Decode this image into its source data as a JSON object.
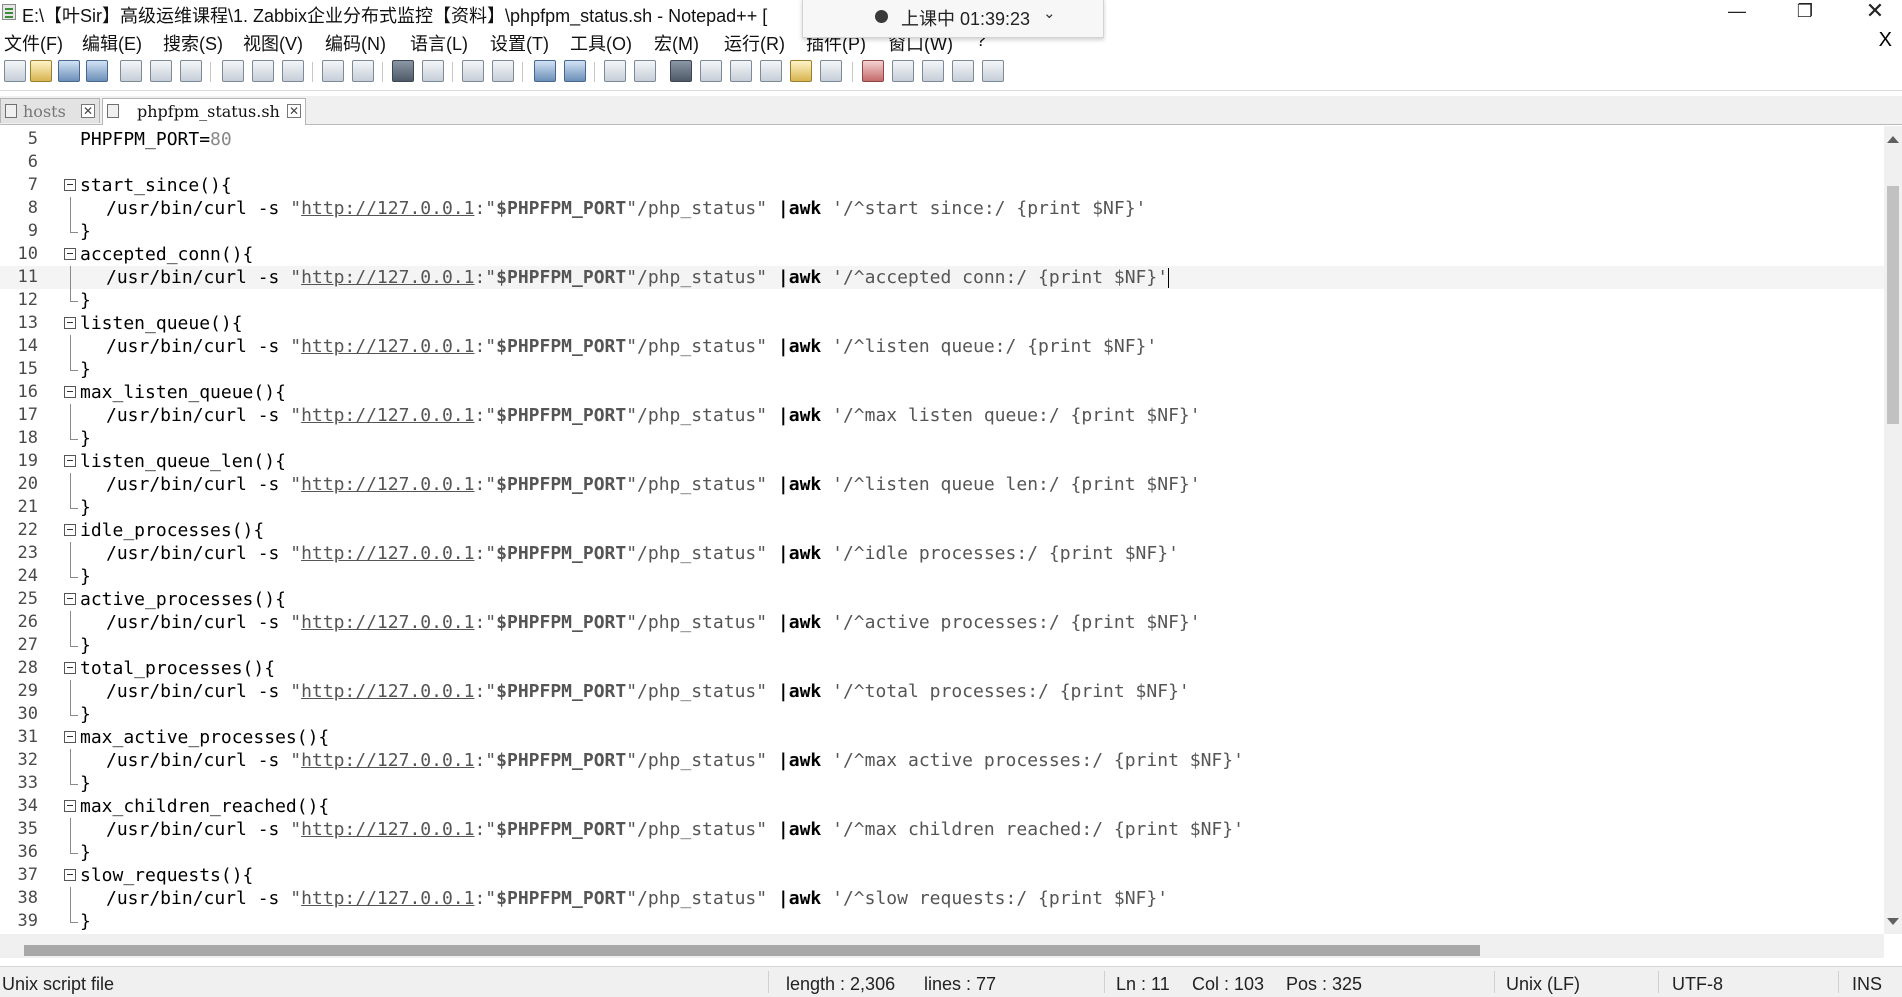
{
  "window": {
    "title": "E:\\【叶Sir】高级运维课程\\1. Zabbix企业分布式监控【资料】\\phpfpm_status.sh - Notepad++ [",
    "minimize_glyph": "—",
    "restore_glyph": "❐",
    "close_glyph": "✕"
  },
  "recording": {
    "text": "上课中 01:39:23",
    "chevron": "⌄"
  },
  "menu": {
    "items": [
      "文件(F)",
      "编辑(E)",
      "搜索(S)",
      "视图(V)",
      "编码(N)",
      "语言(L)",
      "设置(T)",
      "工具(O)",
      "宏(M)",
      "运行(R)",
      "插件(P)",
      "窗口(W)",
      "?"
    ],
    "close_glyph": "X"
  },
  "tabs": [
    {
      "label": "hosts",
      "active": false
    },
    {
      "label": "phpfpm_status.sh",
      "active": true
    }
  ],
  "editor": {
    "current_line": 11,
    "lines": [
      {
        "n": "5",
        "kind": "plain",
        "fold": "none",
        "text": "PHPFPM_PORT=80"
      },
      {
        "n": "6",
        "kind": "blank",
        "fold": "none",
        "text": ""
      },
      {
        "n": "7",
        "kind": "func",
        "fold": "start",
        "text": "start_since(){"
      },
      {
        "n": "8",
        "kind": "curl",
        "fold": "mid",
        "pattern": "'/^start since:/ {print $NF}'"
      },
      {
        "n": "9",
        "kind": "close",
        "fold": "end",
        "text": "}"
      },
      {
        "n": "10",
        "kind": "func",
        "fold": "start",
        "text": "accepted_conn(){"
      },
      {
        "n": "11",
        "kind": "curl",
        "fold": "mid",
        "pattern": "'/^accepted conn:/ {print $NF}'"
      },
      {
        "n": "12",
        "kind": "close",
        "fold": "end",
        "text": "}"
      },
      {
        "n": "13",
        "kind": "func",
        "fold": "start",
        "text": "listen_queue(){"
      },
      {
        "n": "14",
        "kind": "curl",
        "fold": "mid",
        "pattern": "'/^listen queue:/ {print $NF}'"
      },
      {
        "n": "15",
        "kind": "close",
        "fold": "end",
        "text": "}"
      },
      {
        "n": "16",
        "kind": "func",
        "fold": "start",
        "text": "max_listen_queue(){"
      },
      {
        "n": "17",
        "kind": "curl",
        "fold": "mid",
        "pattern": "'/^max listen queue:/ {print $NF}'"
      },
      {
        "n": "18",
        "kind": "close",
        "fold": "end",
        "text": "}"
      },
      {
        "n": "19",
        "kind": "func",
        "fold": "start",
        "text": "listen_queue_len(){"
      },
      {
        "n": "20",
        "kind": "curl",
        "fold": "mid",
        "pattern": "'/^listen queue len:/ {print $NF}'"
      },
      {
        "n": "21",
        "kind": "close",
        "fold": "end",
        "text": "}"
      },
      {
        "n": "22",
        "kind": "func",
        "fold": "start",
        "text": "idle_processes(){"
      },
      {
        "n": "23",
        "kind": "curl",
        "fold": "mid",
        "pattern": "'/^idle processes:/ {print $NF}'"
      },
      {
        "n": "24",
        "kind": "close",
        "fold": "end",
        "text": "}"
      },
      {
        "n": "25",
        "kind": "func",
        "fold": "start",
        "text": "active_processes(){"
      },
      {
        "n": "26",
        "kind": "curl",
        "fold": "mid",
        "pattern": "'/^active processes:/ {print $NF}'"
      },
      {
        "n": "27",
        "kind": "close",
        "fold": "end",
        "text": "}"
      },
      {
        "n": "28",
        "kind": "func",
        "fold": "start",
        "text": "total_processes(){"
      },
      {
        "n": "29",
        "kind": "curl",
        "fold": "mid",
        "pattern": "'/^total processes:/ {print $NF}'"
      },
      {
        "n": "30",
        "kind": "close",
        "fold": "end",
        "text": "}"
      },
      {
        "n": "31",
        "kind": "func",
        "fold": "start",
        "text": "max_active_processes(){"
      },
      {
        "n": "32",
        "kind": "curl",
        "fold": "mid",
        "pattern": "'/^max active processes:/ {print $NF}'"
      },
      {
        "n": "33",
        "kind": "close",
        "fold": "end",
        "text": "}"
      },
      {
        "n": "34",
        "kind": "func",
        "fold": "start",
        "text": "max_children_reached(){"
      },
      {
        "n": "35",
        "kind": "curl",
        "fold": "mid",
        "pattern": "'/^max children reached:/ {print $NF}'"
      },
      {
        "n": "36",
        "kind": "close",
        "fold": "end",
        "text": "}"
      },
      {
        "n": "37",
        "kind": "func",
        "fold": "start",
        "text": "slow_requests(){"
      },
      {
        "n": "38",
        "kind": "curl",
        "fold": "mid",
        "pattern": "'/^slow requests:/ {print $NF}'"
      },
      {
        "n": "39",
        "kind": "close",
        "fold": "end",
        "text": "}"
      }
    ],
    "curl_parts": {
      "cmd": "/usr/bin/curl -s ",
      "q1": "\"",
      "url": "http://127.0.0.1",
      "colon": ":\"",
      "var": "$PHPFPM_PORT",
      "path": "\"/php_status\" ",
      "pipe": "|awk",
      "space": " "
    }
  },
  "status": {
    "file_type": "Unix script file",
    "length": "length : 2,306",
    "lines": "lines : 77",
    "ln": "Ln : 11",
    "col": "Col : 103",
    "pos": "Pos : 325",
    "eol": "Unix (LF)",
    "encoding": "UTF-8",
    "mode": "INS"
  }
}
